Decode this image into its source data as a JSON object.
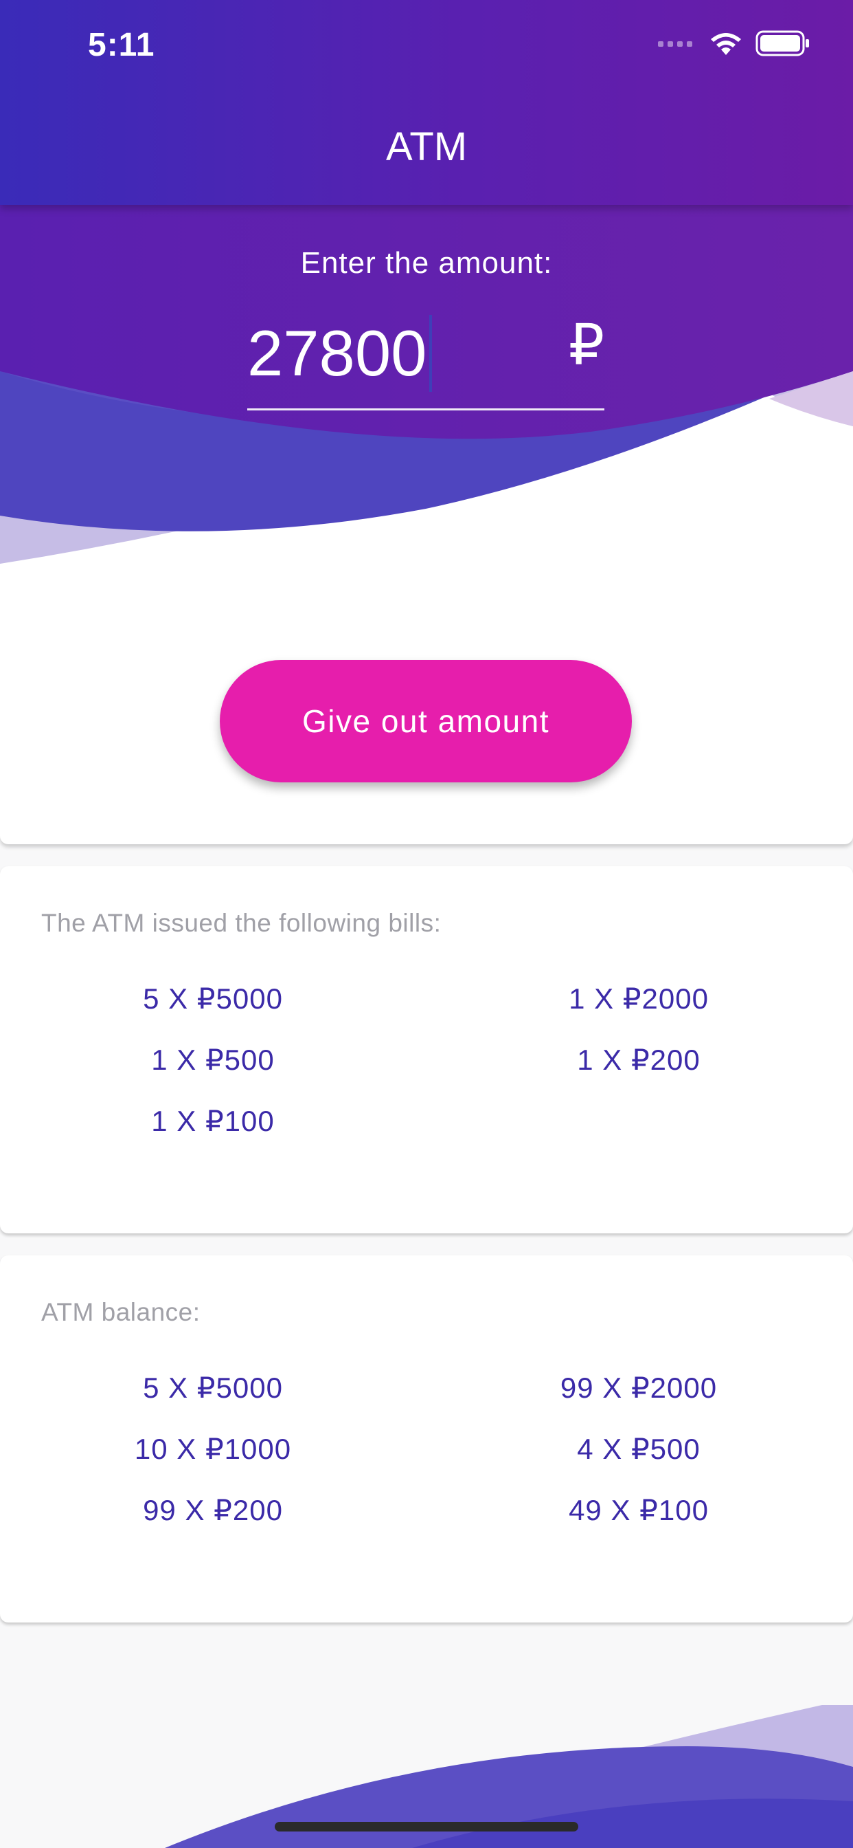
{
  "status_bar": {
    "time": "5:11",
    "icons": [
      "signal-icon",
      "wifi-icon",
      "battery-icon"
    ]
  },
  "app_bar": {
    "title": "ATM"
  },
  "amount_entry": {
    "prompt": "Enter the amount:",
    "value": "27800",
    "currency": "₽"
  },
  "actions": {
    "give_out_label": "Give out amount"
  },
  "issued": {
    "title": "The ATM issued the following bills:",
    "bills": [
      "5 X ₽5000",
      "1 X ₽2000",
      "1 X ₽500",
      "1 X ₽200",
      "1 X ₽100"
    ]
  },
  "balance": {
    "title": "ATM balance:",
    "bills": [
      "5 X ₽5000",
      "99 X ₽2000",
      "10 X ₽1000",
      "4 X ₽500",
      "99 X ₽200",
      "49 X ₽100"
    ]
  },
  "colors": {
    "primary_purple": "#5a20b0",
    "accent_pink": "#e61eac",
    "bill_text": "#3b2aa8",
    "wave_blue": "#4a3fbf"
  }
}
